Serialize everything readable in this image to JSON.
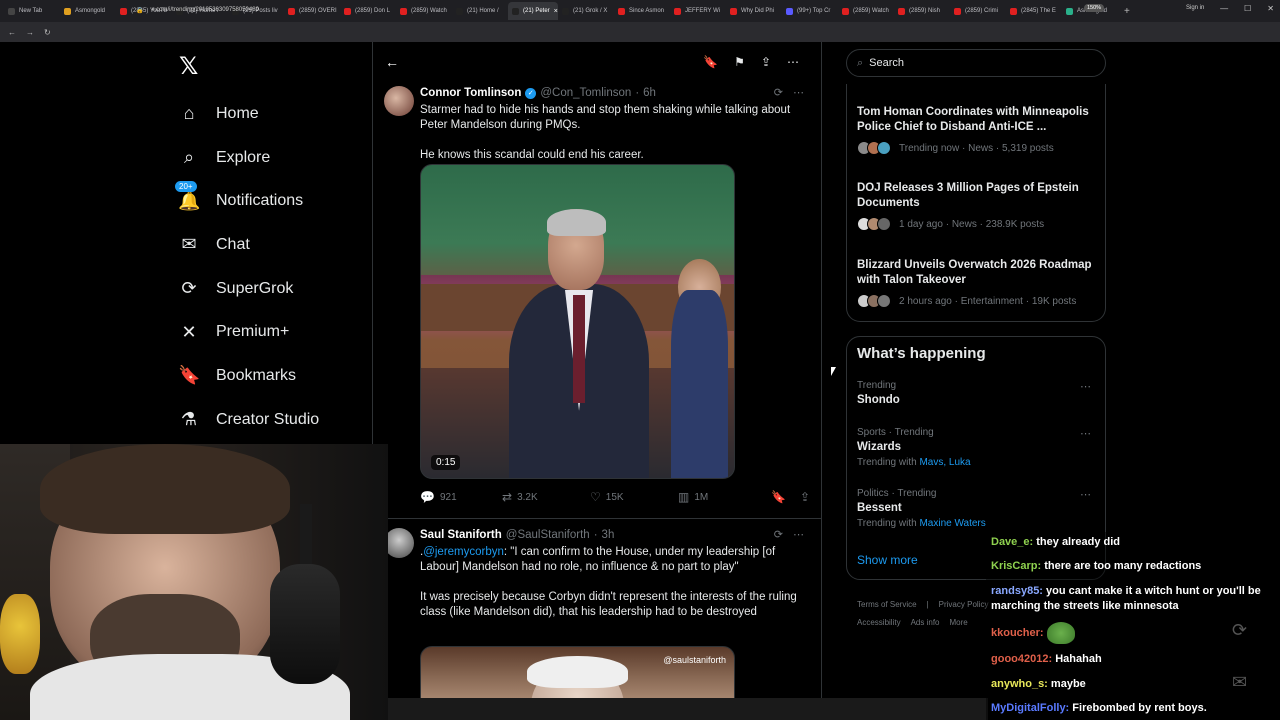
{
  "browser": {
    "tabs": [
      "New Tab",
      "Asmongold",
      "(2845) YouTu",
      "(21) Home /",
      "(21) Posts liv",
      "(2859) OVERI",
      "(2859) Don L",
      "(2859) Watch",
      "(21) Home /",
      "(21) Peter",
      "(21) Grok / X",
      "Since Asmon",
      "JEFFERY Wi",
      "Why Did Phi",
      "(99+) Top Cr",
      "(2859) Watch",
      "(2859) Nish",
      "(2859) Crimi",
      "(2845) The E",
      "Asmongold"
    ],
    "active_tab_index": 9,
    "url": "x.com/i/trending/2018536309758050489",
    "zoom": "150%",
    "sign_in": "Sign in"
  },
  "nav": {
    "items": [
      {
        "label": "Home",
        "icon": "home-icon"
      },
      {
        "label": "Explore",
        "icon": "search-icon"
      },
      {
        "label": "Notifications",
        "icon": "bell-icon",
        "badge": "20+"
      },
      {
        "label": "Chat",
        "icon": "mail-icon"
      },
      {
        "label": "SuperGrok",
        "icon": "grok-icon"
      },
      {
        "label": "Premium+",
        "icon": "x-icon"
      },
      {
        "label": "Bookmarks",
        "icon": "bookmark-icon"
      },
      {
        "label": "Creator Studio",
        "icon": "flask-icon"
      }
    ]
  },
  "post1": {
    "name": "Connor Tomlinson",
    "handle": "@Con_Tomlinson",
    "time": "6h",
    "text": "Starmer had to hide his hands and stop them shaking while talking about Peter Mandelson during PMQs.\n\nHe knows this scandal could end his career.",
    "duration": "0:15",
    "replies": "921",
    "reposts": "3.2K",
    "likes": "15K",
    "views": "1M"
  },
  "post2": {
    "name": "Saul Staniforth",
    "handle": "@SaulStaniforth",
    "time": "3h",
    "mention": "@jeremycorbyn",
    "text_prefix": ".",
    "text_after_mention": ": \"I can confirm to the House, under my leadership [of Labour] Mandelson had no role, no influence & no part to play\"",
    "text2": "It was precisely because Corbyn didn't represent the interests of the ruling class (like Mandelson did), that his leadership had to be destroyed",
    "watermark": "@saulstaniforth"
  },
  "search": {
    "placeholder": "Search"
  },
  "news": [
    {
      "title": "Tom Homan Coordinates with Minneapolis Police Chief to Disband Anti-ICE ...",
      "meta": "Trending now · News · 5,319 posts"
    },
    {
      "title": "DOJ Releases 3 Million Pages of Epstein Documents",
      "meta": "1 day ago · News · 238.9K posts"
    },
    {
      "title": "Blizzard Unveils Overwatch 2026 Roadmap with Talon Takeover",
      "meta": "2 hours ago · Entertainment · 19K posts"
    }
  ],
  "happening": {
    "title": "What’s happening",
    "trends": [
      {
        "category": "Trending",
        "name": "Shondo",
        "with_label": "",
        "with_links": ""
      },
      {
        "category": "Sports · Trending",
        "name": "Wizards",
        "with_label": "Trending with",
        "with_links": "Mavs, Luka"
      },
      {
        "category": "Politics · Trending",
        "name": "Bessent",
        "with_label": "Trending with",
        "with_links": "Maxine Waters"
      }
    ],
    "show_more": "Show more"
  },
  "footer": [
    "Terms of Service",
    "|",
    "Privacy Policy",
    "Accessibility",
    "Ads info",
    "More"
  ],
  "chat": [
    {
      "user": "Dave_e:",
      "color": "#8fd14f",
      "msg": "they already did"
    },
    {
      "user": "KrisCarp:",
      "color": "#8fd14f",
      "msg": "there are too many redactions"
    },
    {
      "user": "randsy85:",
      "color": "#8aa8ff",
      "msg": "you cant make it a witch hunt or you'll be marching the streets like minnesota"
    },
    {
      "user": "kkoucher:",
      "color": "#e0604a",
      "msg": ""
    },
    {
      "user": "gooo42012:",
      "color": "#e0604a",
      "msg": "Hahahah"
    },
    {
      "user": "anywho_s:",
      "color": "#e8e85a",
      "msg": "maybe"
    },
    {
      "user": "MyDigitalFolly:",
      "color": "#5a7aff",
      "msg": "Firebombed by rent boys."
    }
  ]
}
